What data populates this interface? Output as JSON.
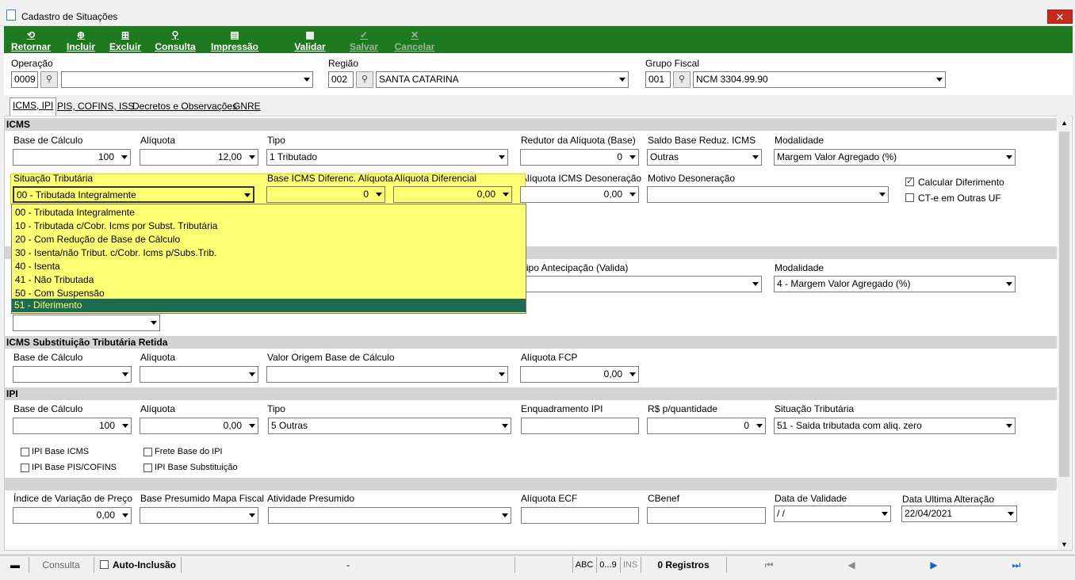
{
  "window": {
    "title": "Cadastro de Situações",
    "close": "✕"
  },
  "toolbar": {
    "retornar": "Retornar",
    "incluir": "Incluir",
    "excluir": "Excluir",
    "consulta": "Consulta",
    "impressao": "Impressão",
    "validar": "Validar",
    "salvar": "Salvar",
    "cancelar": "Cancelar"
  },
  "header": {
    "operacao_label": "Operação",
    "operacao_code": "0009",
    "operacao_desc": "",
    "regiao_label": "Região",
    "regiao_code": "002",
    "regiao_desc": "SANTA CATARINA",
    "grupo_label": "Grupo Fiscal",
    "grupo_code": "001",
    "grupo_desc": "NCM 3304.99.90"
  },
  "tabs": [
    "ICMS, IPI",
    "PIS, COFINS, ISS",
    "Decretos e Observações",
    "GNRE"
  ],
  "icms": {
    "section": "ICMS",
    "base_label": "Base de Cálculo",
    "base_value": "100",
    "aliq_label": "Alíquota",
    "aliq_value": "12,00",
    "tipo_label": "Tipo",
    "tipo_value": "1 Tributado",
    "redutor_label": "Redutor da Alíquota (Base)",
    "redutor_value": "0",
    "saldo_label": "Saldo Base Reduz. ICMS",
    "saldo_value": "Outras",
    "modal_label": "Modalidade",
    "modal_value": "Margem Valor Agregado (%)",
    "sit_label": "Situação Tributária",
    "sit_value": "00 - Tributada Integralmente",
    "basedif_label": "Base ICMS Diferenc. Alíquota",
    "basedif_value": "0",
    "aliqdif_label": "Alíquota Diferencial",
    "aliqdif_value": "0,00",
    "aliqdes_label": "Alíquota ICMS Desoneração",
    "aliqdes_value": "0,00",
    "motivo_label": "Motivo Desoneração",
    "motivo_value": "",
    "calc_dif": "Calcular Diferimento",
    "cte": "CT-e em Outras UF"
  },
  "situacao_options": [
    "00 - Tributada Integralmente",
    "10 - Tributada c/Cobr. Icms por Subst. Tributária",
    "20 - Com Redução de Base de Cálculo",
    "30 - Isenta/não Tribut. c/Cobr. Icms p/Subs.Trib.",
    "40 - Isenta",
    "41 - Não Tributada",
    "50 - Com Suspensão",
    "51 - Diferimento"
  ],
  "st": {
    "tipo_ant_label": "Tipo Antecipação (Valida)",
    "tipo_ant_value": "",
    "modal_label": "Modalidade",
    "modal_value": "4 - Margem Valor Agregado (%)"
  },
  "retida": {
    "section": "ICMS Substituição Tributária Retida",
    "base_label": "Base de Cálculo",
    "aliq_label": "Alíquota",
    "valor_label": "Valor Origem Base de Cálculo",
    "fcp_label": "Alíquota FCP",
    "fcp_value": "0,00"
  },
  "ipi": {
    "section": "IPI",
    "base_label": "Base de Cálculo",
    "base_value": "100",
    "aliq_label": "Alíquota",
    "aliq_value": "0,00",
    "tipo_label": "Tipo",
    "tipo_value": "5 Outras",
    "enq_label": "Enquadramento IPI",
    "enq_value": "",
    "rsq_label": "R$ p/quantidade",
    "rsq_value": "0",
    "sit_label": "Situação Tributária",
    "sit_value": "51 - Saida tributada com aliq. zero",
    "chk_base_icms": "IPI Base ICMS",
    "chk_frete": "Frete Base do IPI",
    "chk_pis": "IPI Base PIS/COFINS",
    "chk_subst": "IPI Base Substituição"
  },
  "outros": {
    "indice_label": "Índice de Variação de Preço",
    "indice_value": "0,00",
    "basepres_label": "Base Presumido Mapa Fiscal",
    "ativ_label": "Atividade Presumido",
    "aliqecf_label": "Alíquota ECF",
    "cbenef_label": "CBenef",
    "validade_label": "Data de Validade",
    "validade_value": " /  /",
    "ultima_label": "Data Ultima Alteração",
    "ultima_value": "22/04/2021"
  },
  "status": {
    "consulta": "Consulta",
    "auto": "Auto-Inclusão",
    "dash": "-",
    "abc": "ABC",
    "num": "0...9",
    "ins": "INS",
    "registros": "0 Registros"
  }
}
